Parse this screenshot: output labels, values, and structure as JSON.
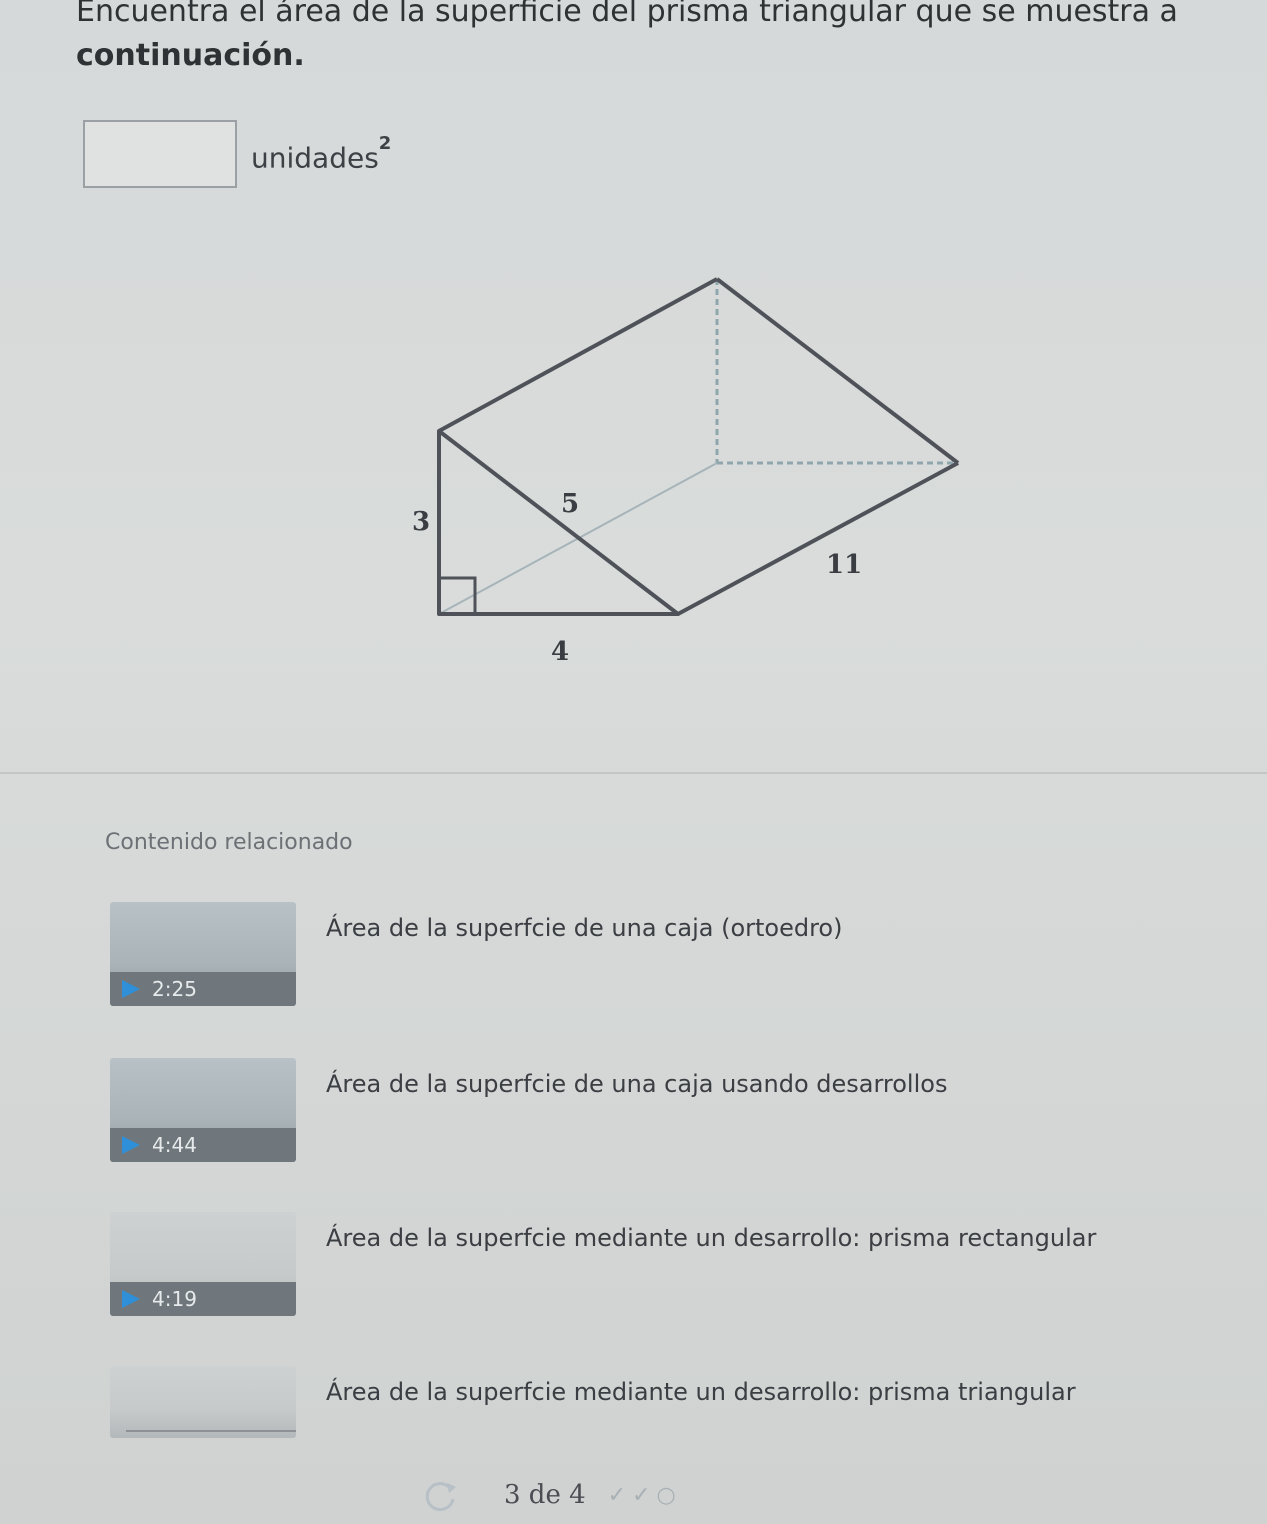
{
  "question": {
    "line1": "Encuentra el área de la superficie del prisma triangular que se muestra a",
    "line2": "continuación."
  },
  "answer": {
    "value": "",
    "placeholder": "",
    "unit": "unidades",
    "unit_exponent": "2"
  },
  "figure": {
    "labels": {
      "height": "3",
      "hypotenuse": "5",
      "base": "4",
      "length": "11"
    }
  },
  "related": {
    "title": "Contenido relacionado",
    "items": [
      {
        "title": "Área de la superfcie de una caja (ortoedro)",
        "duration": "2:25"
      },
      {
        "title": "Área de la superfcie de una caja usando desarrollos",
        "duration": "4:44"
      },
      {
        "title": "Área de la superfcie mediante un desarrollo: prisma rectangular",
        "duration": "4:19"
      },
      {
        "title": "Área de la superfcie mediante un desarrollo: prisma triangular",
        "duration": ""
      }
    ]
  },
  "pager": {
    "text": "3 de 4"
  }
}
